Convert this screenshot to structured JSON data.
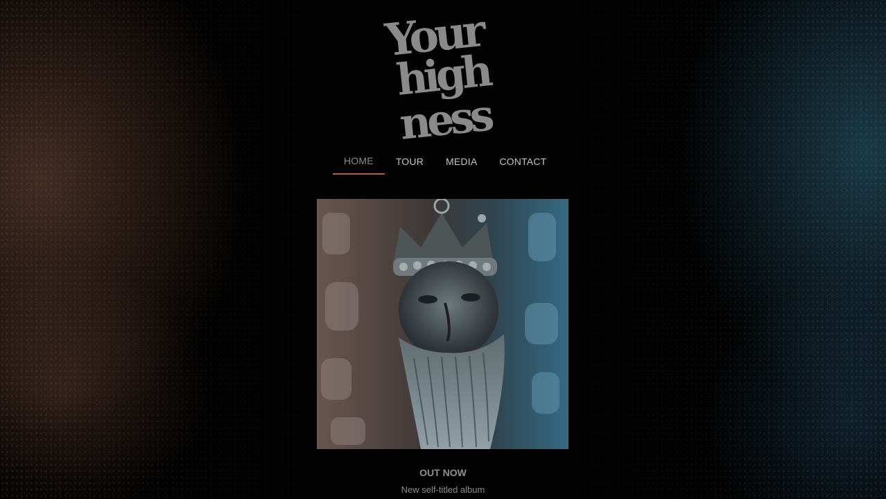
{
  "brand": {
    "logo_text": "Your High Ness",
    "logo_icon": "blackletter-logo-icon"
  },
  "nav": {
    "items": [
      {
        "label": "HOME",
        "active": true
      },
      {
        "label": "TOUR",
        "active": false
      },
      {
        "label": "MEDIA",
        "active": false
      },
      {
        "label": "CONTACT",
        "active": false
      }
    ]
  },
  "hero": {
    "cover_image": "album-cover-crowned-bearded-king",
    "headline": "OUT NOW",
    "subheadline": "New self-titled album"
  },
  "colors": {
    "background": "#000000",
    "nav_text": "#c9c2bb",
    "nav_active_underline": "#c0584a",
    "logo": "#8a8a8a",
    "accent_left": "#784e3c",
    "accent_right": "#285f78"
  }
}
